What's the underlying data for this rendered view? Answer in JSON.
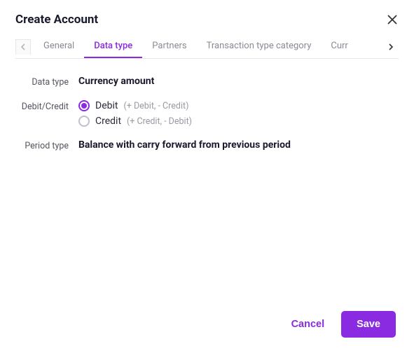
{
  "header": {
    "title": "Create Account"
  },
  "tabs": {
    "items": [
      {
        "label": "General"
      },
      {
        "label": "Data type"
      },
      {
        "label": "Partners"
      },
      {
        "label": "Transaction type category"
      },
      {
        "label": "Curr"
      }
    ]
  },
  "form": {
    "data_type_label": "Data type",
    "data_type_value": "Currency amount",
    "debit_credit_label": "Debit/Credit",
    "debit_label": "Debit",
    "debit_hint": "(+ Debit, - Credit)",
    "credit_label": "Credit",
    "credit_hint": "(+ Credit, - Debit)",
    "period_type_label": "Period type",
    "period_type_value": "Balance with carry forward from previous period"
  },
  "footer": {
    "cancel": "Cancel",
    "save": "Save"
  }
}
